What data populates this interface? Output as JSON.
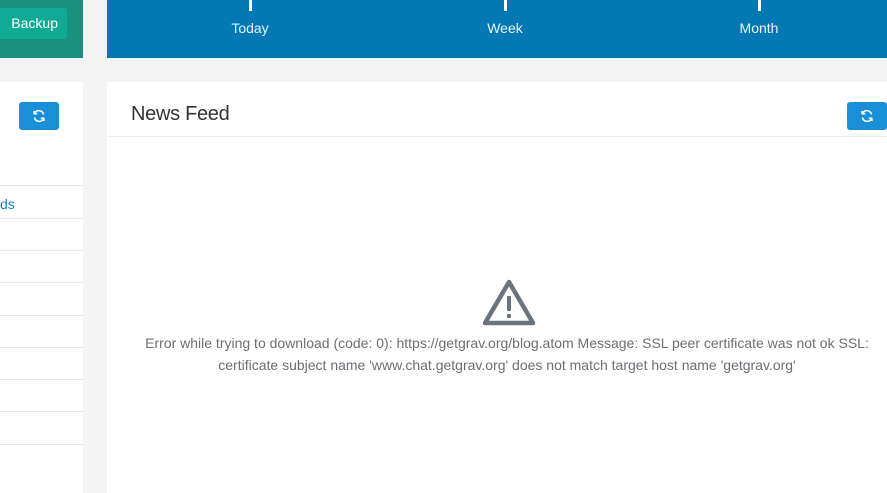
{
  "backup": {
    "button_label": "Backup"
  },
  "stats": {
    "items": [
      {
        "label": "Today"
      },
      {
        "label": "Week"
      },
      {
        "label": "Month"
      }
    ]
  },
  "left_panel": {
    "link_text": "ds",
    "refresh_icon": "refresh-icon"
  },
  "news": {
    "title": "News Feed",
    "refresh_icon": "refresh-icon",
    "warning_icon": "warning-triangle-icon",
    "error_line1": "Error while trying to download (code: 0): https://getgrav.org/blog.atom Message: SSL peer certificate was not ok SSL:",
    "error_line2": "certificate subject name 'www.chat.getgrav.org' does not match target host name 'getgrav.org'"
  },
  "colors": {
    "teal_panel": "#19917e",
    "teal_button": "#0faa94",
    "blue_panel": "#0478b3",
    "button_blue": "#1a8fd8"
  }
}
